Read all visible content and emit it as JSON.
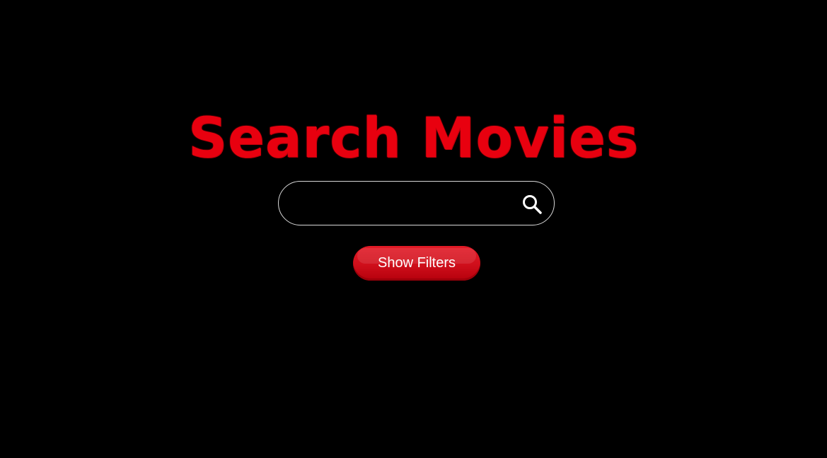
{
  "page": {
    "title": "Search Movies"
  },
  "search": {
    "value": "",
    "placeholder": "",
    "icon": "search-icon"
  },
  "filters": {
    "button_label": "Show Filters"
  },
  "colors": {
    "background": "#000000",
    "accent": "#e8000f",
    "button": "#cf0f1b",
    "search_border": "#d8d8d8",
    "text": "#ffffff"
  }
}
